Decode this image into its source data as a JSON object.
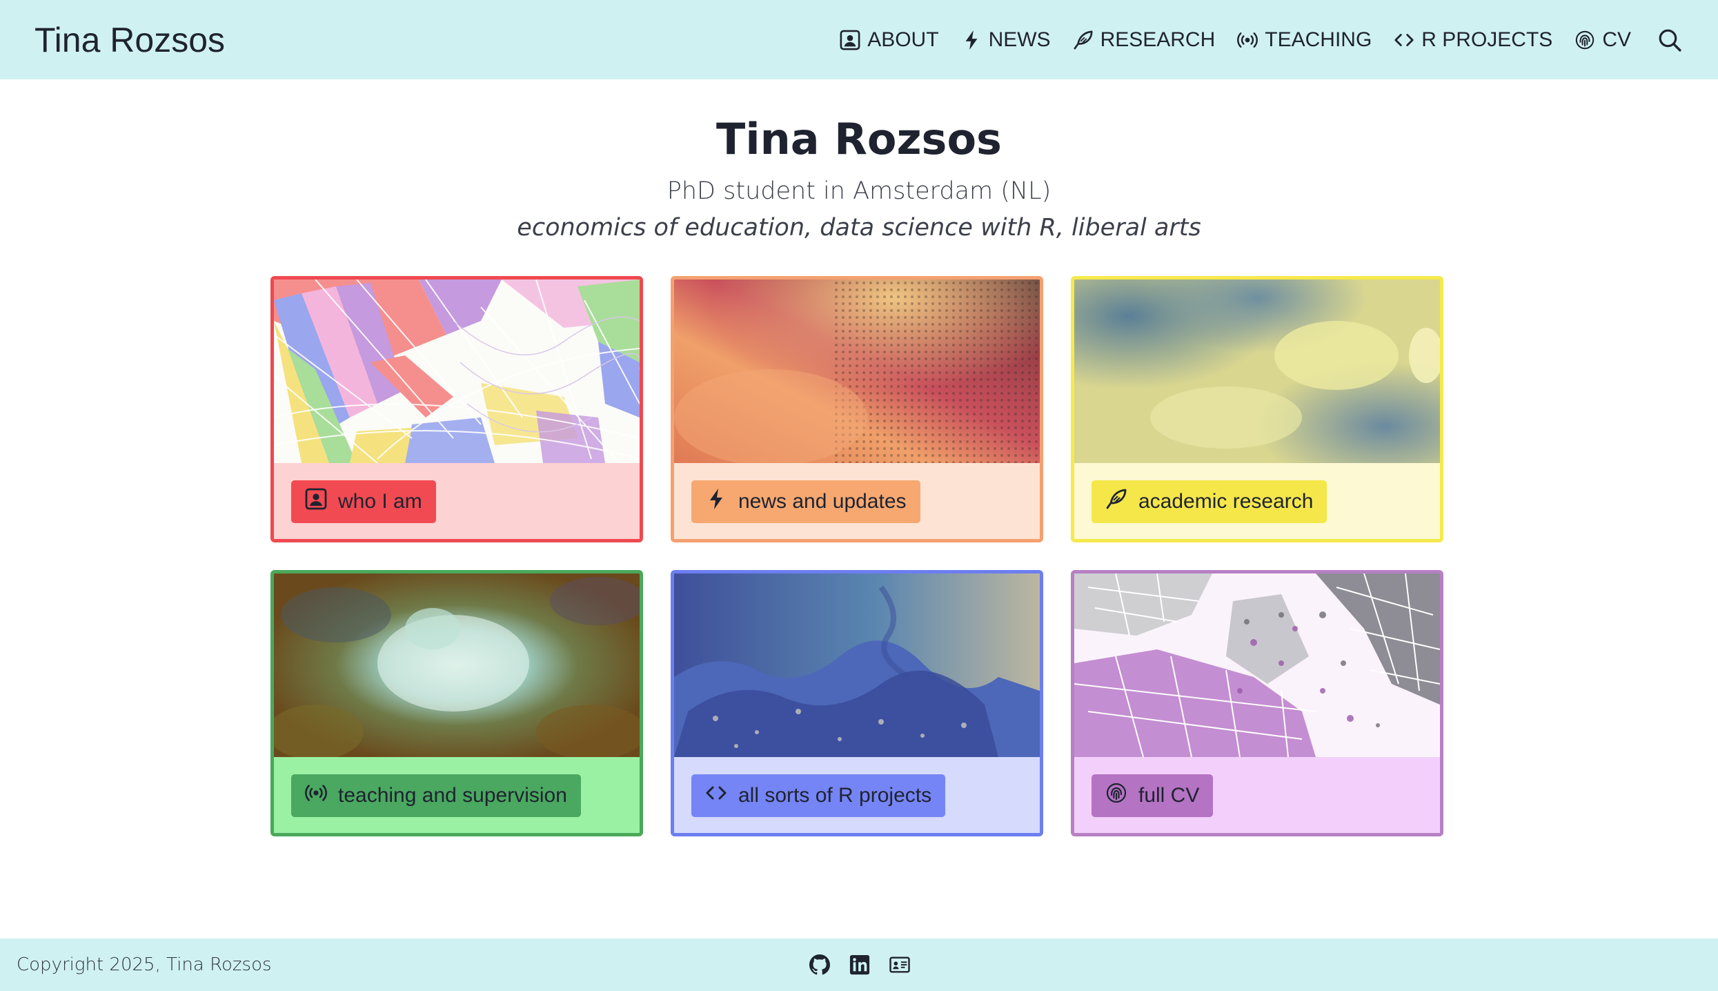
{
  "navbar": {
    "brand": "Tina Rozsos",
    "items": [
      {
        "label": "ABOUT",
        "icon": "person-badge-icon"
      },
      {
        "label": "NEWS",
        "icon": "lightning-icon"
      },
      {
        "label": "RESEARCH",
        "icon": "feather-icon"
      },
      {
        "label": "TEACHING",
        "icon": "broadcast-icon"
      },
      {
        "label": "R PROJECTS",
        "icon": "code-icon"
      },
      {
        "label": "CV",
        "icon": "fingerprint-icon"
      }
    ],
    "search_icon": "search-icon"
  },
  "hero": {
    "title": "Tina Rozsos",
    "subtitle": "PhD student in Amsterdam (NL)",
    "tagline": "economics of education, data science with R, liberal arts"
  },
  "cards": [
    {
      "label": "who I am",
      "icon": "person-badge-icon",
      "color": "#f14a52"
    },
    {
      "label": "news and updates",
      "icon": "lightning-icon",
      "color": "#f6a870"
    },
    {
      "label": "academic research",
      "icon": "feather-icon",
      "color": "#f5e74a"
    },
    {
      "label": "teaching and supervision",
      "icon": "broadcast-icon",
      "color": "#4aa860"
    },
    {
      "label": "all sorts of R projects",
      "icon": "code-icon",
      "color": "#7585f5"
    },
    {
      "label": "full CV",
      "icon": "fingerprint-icon",
      "color": "#b473c3"
    }
  ],
  "footer": {
    "copyright": "Copyright 2025, Tina Rozsos",
    "social": [
      "github-icon",
      "linkedin-icon",
      "email-card-icon"
    ]
  },
  "colors": {
    "navbar_bg": "#d0f1f2",
    "text": "#1f2330"
  }
}
